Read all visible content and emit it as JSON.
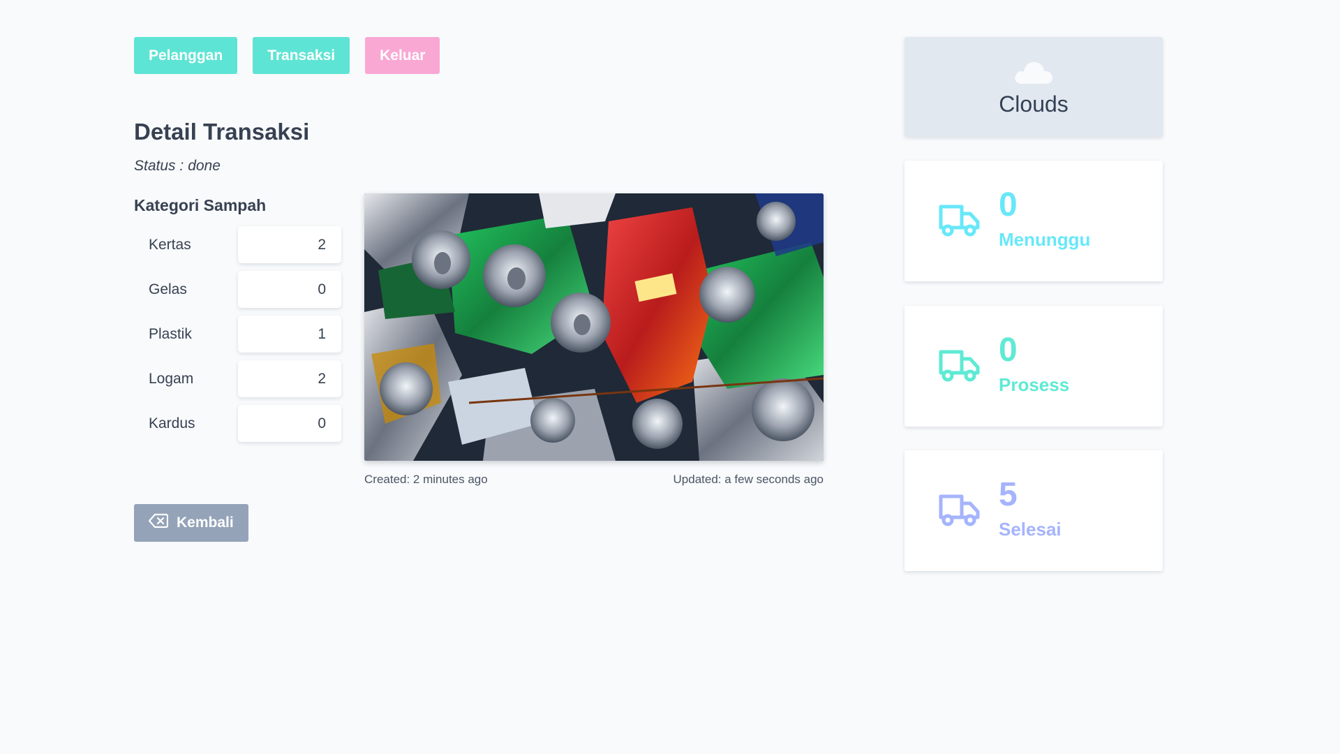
{
  "nav": {
    "items": [
      {
        "label": "Pelanggan"
      },
      {
        "label": "Transaksi"
      },
      {
        "label": "Keluar"
      }
    ]
  },
  "detail": {
    "title": "Detail Transaksi",
    "status_label": "Status :",
    "status_value": "done",
    "kategori_title": "Kategori Sampah",
    "kategori": [
      {
        "label": "Kertas",
        "value": "2"
      },
      {
        "label": "Gelas",
        "value": "0"
      },
      {
        "label": "Plastik",
        "value": "1"
      },
      {
        "label": "Logam",
        "value": "2"
      },
      {
        "label": "Kardus",
        "value": "0"
      }
    ],
    "created": "Created: 2 minutes ago",
    "updated": "Updated: a few seconds ago",
    "back_label": "Kembali"
  },
  "weather": {
    "label": "Clouds",
    "icon": "cloud-icon"
  },
  "stats": [
    {
      "count": "0",
      "label": "Menunggu",
      "color": "#67e8f9",
      "icon": "truck-icon"
    },
    {
      "count": "0",
      "label": "Prosess",
      "color": "#5eead4",
      "icon": "truck-icon"
    },
    {
      "count": "5",
      "label": "Selesai",
      "color": "#a5b4fc",
      "icon": "truck-icon"
    }
  ],
  "colors": {
    "accent_teal": "#5ee4d4",
    "accent_pink": "#f9a8d4",
    "back_button": "#94a3b8",
    "background": "#f8fafc"
  }
}
